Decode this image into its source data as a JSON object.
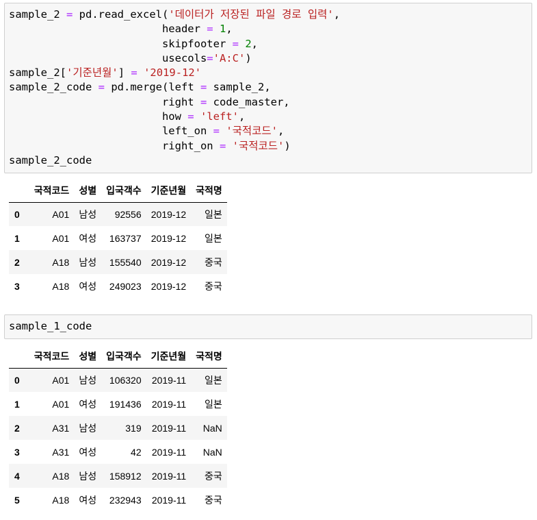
{
  "cell1": {
    "lines": [
      [
        [
          "sample_2 ",
          ""
        ],
        [
          "=",
          "o"
        ],
        [
          " pd.read_excel(",
          ""
        ],
        [
          "'데이터가 저장된 파일 경로 입력'",
          "s"
        ],
        [
          ",",
          ""
        ]
      ],
      [
        [
          "                        header ",
          ""
        ],
        [
          "=",
          "o"
        ],
        [
          " ",
          ""
        ],
        [
          "1",
          "n"
        ],
        [
          ",",
          ""
        ]
      ],
      [
        [
          "                        skipfooter ",
          ""
        ],
        [
          "=",
          "o"
        ],
        [
          " ",
          ""
        ],
        [
          "2",
          "n"
        ],
        [
          ",",
          ""
        ]
      ],
      [
        [
          "                        usecols",
          ""
        ],
        [
          "=",
          "o"
        ],
        [
          "'A:C'",
          "s"
        ],
        [
          ")",
          ""
        ]
      ],
      [
        [
          "sample_2[",
          ""
        ],
        [
          "'기준년월'",
          "s"
        ],
        [
          "] ",
          ""
        ],
        [
          "=",
          "o"
        ],
        [
          " ",
          ""
        ],
        [
          "'2019-12'",
          "s"
        ]
      ],
      [
        [
          "sample_2_code ",
          ""
        ],
        [
          "=",
          "o"
        ],
        [
          " pd.merge(left ",
          ""
        ],
        [
          "=",
          "o"
        ],
        [
          " sample_2,",
          ""
        ]
      ],
      [
        [
          "                        right ",
          ""
        ],
        [
          "=",
          "o"
        ],
        [
          " code_master,",
          ""
        ]
      ],
      [
        [
          "                        how ",
          ""
        ],
        [
          "=",
          "o"
        ],
        [
          " ",
          ""
        ],
        [
          "'left'",
          "s"
        ],
        [
          ",",
          ""
        ]
      ],
      [
        [
          "                        left_on ",
          ""
        ],
        [
          "=",
          "o"
        ],
        [
          " ",
          ""
        ],
        [
          "'국적코드'",
          "s"
        ],
        [
          ",",
          ""
        ]
      ],
      [
        [
          "                        right_on ",
          ""
        ],
        [
          "=",
          "o"
        ],
        [
          " ",
          ""
        ],
        [
          "'국적코드'",
          "s"
        ],
        [
          ")",
          ""
        ]
      ],
      [
        [
          "sample_2_code",
          ""
        ]
      ]
    ]
  },
  "table1": {
    "columns": [
      "",
      "국적코드",
      "성별",
      "입국객수",
      "기준년월",
      "국적명"
    ],
    "rows": [
      [
        "0",
        "A01",
        "남성",
        "92556",
        "2019-12",
        "일본"
      ],
      [
        "1",
        "A01",
        "여성",
        "163737",
        "2019-12",
        "일본"
      ],
      [
        "2",
        "A18",
        "남성",
        "155540",
        "2019-12",
        "중국"
      ],
      [
        "3",
        "A18",
        "여성",
        "249023",
        "2019-12",
        "중국"
      ]
    ]
  },
  "cell2": {
    "lines": [
      [
        [
          "sample_1_code",
          ""
        ]
      ]
    ]
  },
  "table2": {
    "columns": [
      "",
      "국적코드",
      "성별",
      "입국객수",
      "기준년월",
      "국적명"
    ],
    "rows": [
      [
        "0",
        "A01",
        "남성",
        "106320",
        "2019-11",
        "일본"
      ],
      [
        "1",
        "A01",
        "여성",
        "191436",
        "2019-11",
        "일본"
      ],
      [
        "2",
        "A31",
        "남성",
        "319",
        "2019-11",
        "NaN"
      ],
      [
        "3",
        "A31",
        "여성",
        "42",
        "2019-11",
        "NaN"
      ],
      [
        "4",
        "A18",
        "남성",
        "158912",
        "2019-11",
        "중국"
      ],
      [
        "5",
        "A18",
        "여성",
        "232943",
        "2019-11",
        "중국"
      ]
    ]
  },
  "colors": {
    "operator": "#aa22ff",
    "string": "#ba2121",
    "number": "#008000",
    "cell_bg": "#f7f7f7",
    "row_stripe": "#f5f5f5"
  }
}
